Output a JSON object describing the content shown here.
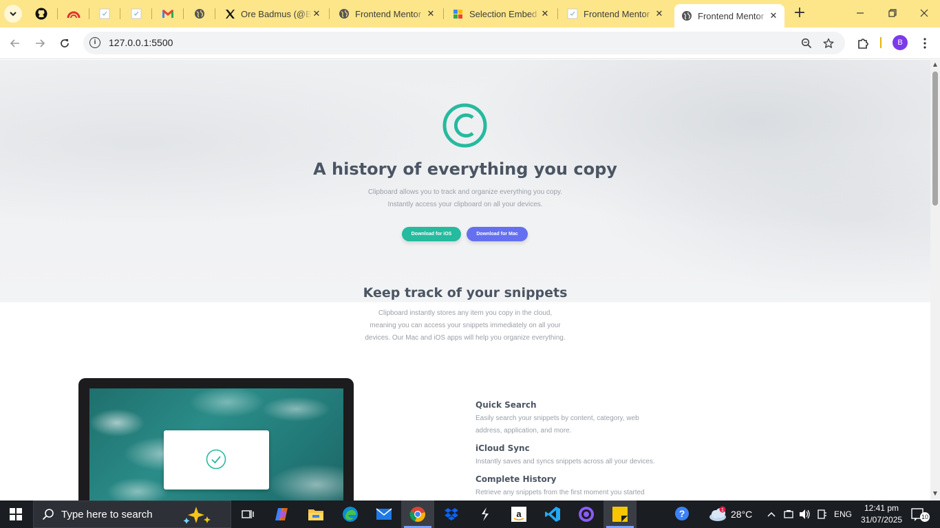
{
  "browser": {
    "tabs": [
      {
        "title": "Ore Badmus (@Ba",
        "icon": "x-logo-icon"
      },
      {
        "title": "Frontend Mentor",
        "icon": "globe-icon"
      },
      {
        "title": "Selection Embed",
        "icon": "docs-icon"
      },
      {
        "title": "Frontend Mentor",
        "icon": "page-icon"
      },
      {
        "title": "Frontend Mentor",
        "icon": "globe-icon",
        "active": true
      }
    ],
    "url": "127.0.0.1:5500",
    "profile_initial": "B",
    "new_tab": "+",
    "close_glyph": "✕"
  },
  "page": {
    "hero": {
      "title": "A history of everything you copy",
      "subtitle_line1": "Clipboard allows you to track and organize everything you copy.",
      "subtitle_line2": "Instantly access your clipboard on all your devices.",
      "ios_button": "Download for iOS",
      "mac_button": "Download for Mac"
    },
    "snippets": {
      "title": "Keep track of your snippets",
      "line1": "Clipboard instantly stores any item you copy in the cloud,",
      "line2": "meaning you can access your snippets immediately on all your",
      "line3": "devices. Our Mac and iOS apps will help you organize everything."
    },
    "features": [
      {
        "title": "Quick Search",
        "line1": "Easily search your snippets by content, category, web",
        "line2": "address, application, and more."
      },
      {
        "title": "iCloud Sync",
        "line1": "Instantly saves and syncs snippets across all your devices."
      },
      {
        "title": "Complete History",
        "line1": "Retrieve any snippets from the first moment you started"
      }
    ],
    "colors": {
      "accent_teal": "#26ba9f",
      "accent_blue": "#6470f0",
      "heading": "#4b5563"
    }
  },
  "taskbar": {
    "search_placeholder": "Type here to search",
    "temperature": "28°C",
    "weather_badge": "1",
    "language": "ENG",
    "time": "12:41 pm",
    "date": "31/07/2025",
    "notification_count": "10"
  }
}
